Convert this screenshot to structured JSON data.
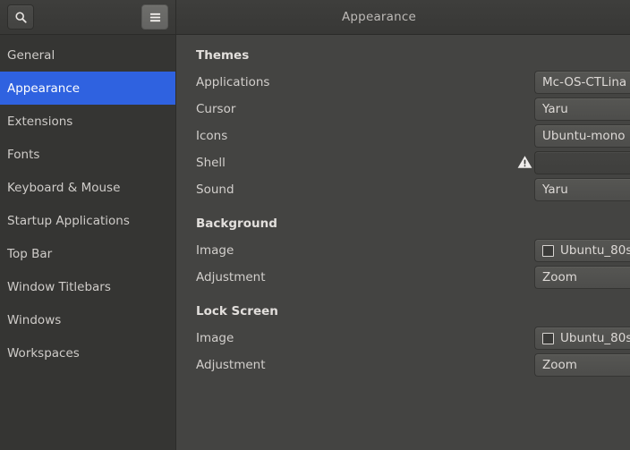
{
  "header": {
    "title": "Appearance",
    "search_icon": "search-icon",
    "menu_icon": "hamburger-menu-icon"
  },
  "sidebar": {
    "items": [
      {
        "label": "General",
        "selected": false
      },
      {
        "label": "Appearance",
        "selected": true
      },
      {
        "label": "Extensions",
        "selected": false
      },
      {
        "label": "Fonts",
        "selected": false
      },
      {
        "label": "Keyboard & Mouse",
        "selected": false
      },
      {
        "label": "Startup Applications",
        "selected": false
      },
      {
        "label": "Top Bar",
        "selected": false
      },
      {
        "label": "Window Titlebars",
        "selected": false
      },
      {
        "label": "Windows",
        "selected": false
      },
      {
        "label": "Workspaces",
        "selected": false
      }
    ]
  },
  "content": {
    "themes": {
      "heading": "Themes",
      "rows": [
        {
          "label": "Applications",
          "value": "Mc-OS-CTLina",
          "warning": false,
          "thumbnail": false
        },
        {
          "label": "Cursor",
          "value": "Yaru",
          "warning": false,
          "thumbnail": false
        },
        {
          "label": "Icons",
          "value": "Ubuntu-mono",
          "warning": false,
          "thumbnail": false
        },
        {
          "label": "Shell",
          "value": "",
          "warning": true,
          "thumbnail": false
        },
        {
          "label": "Sound",
          "value": "Yaru",
          "warning": false,
          "thumbnail": false
        }
      ]
    },
    "background": {
      "heading": "Background",
      "rows": [
        {
          "label": "Image",
          "value": "Ubuntu_80s",
          "warning": false,
          "thumbnail": true
        },
        {
          "label": "Adjustment",
          "value": "Zoom",
          "warning": false,
          "thumbnail": false
        }
      ]
    },
    "lock_screen": {
      "heading": "Lock Screen",
      "rows": [
        {
          "label": "Image",
          "value": "Ubuntu_80s",
          "warning": false,
          "thumbnail": true
        },
        {
          "label": "Adjustment",
          "value": "Zoom",
          "warning": false,
          "thumbnail": false
        }
      ]
    }
  },
  "colors": {
    "accent": "#2f62e0",
    "sidebar_bg": "#353533",
    "content_bg": "#444442",
    "header_bg": "#3a3a38",
    "warning": "#f0eeec"
  }
}
